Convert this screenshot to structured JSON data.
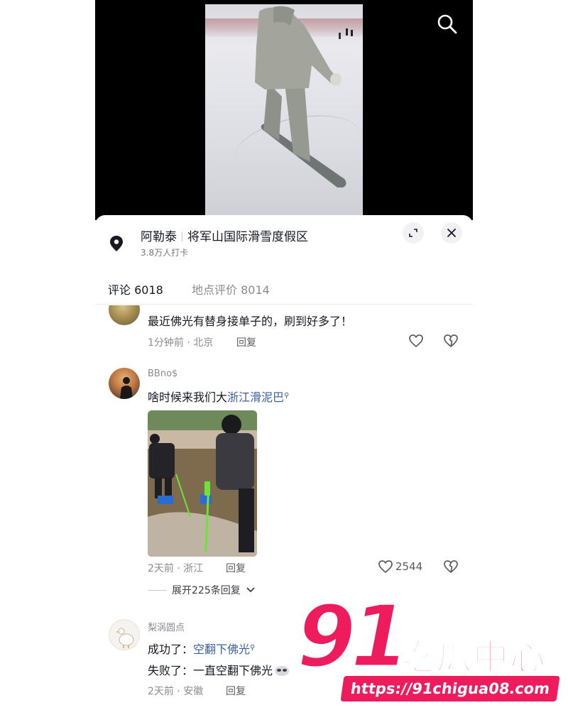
{
  "location": {
    "name": "阿勒泰",
    "place": "将军山国际滑雪度假区",
    "checkins": "3.8万人打卡"
  },
  "tabs": {
    "comments": "评论 6018",
    "reviews": "地点评价 8014"
  },
  "comments": [
    {
      "user": "",
      "text": "最近佛光有替身接单子的，刷到好多了！",
      "time": "1分钟前 · 北京",
      "reply_label": "回复",
      "likes": ""
    },
    {
      "user": "BBno$",
      "text_prefix": "啥时候来我们大",
      "text_link": "浙江滑泥巴",
      "time": "2天前 · 浙江",
      "reply_label": "回复",
      "likes": "2544",
      "expand_replies": "展开225条回复"
    },
    {
      "user": "梨涡圆点",
      "line1_prefix": "成功了：",
      "line1_link": "空翻下佛光",
      "line2": "失败了：一直空翻下佛光",
      "time": "2天前 · 安徽",
      "reply_label": "回复"
    }
  ],
  "watermark": {
    "number": "91",
    "name": "吃瓜中心",
    "url": "https://91chigua08.com"
  },
  "icons": {
    "search": "search-icon",
    "location": "location-pin-icon",
    "expand": "expand-icon",
    "close": "close-icon",
    "like": "heart-icon",
    "dislike": "broken-heart-icon"
  },
  "colors": {
    "link": "#3a5f9e",
    "watermark": "#ee1c5d"
  }
}
